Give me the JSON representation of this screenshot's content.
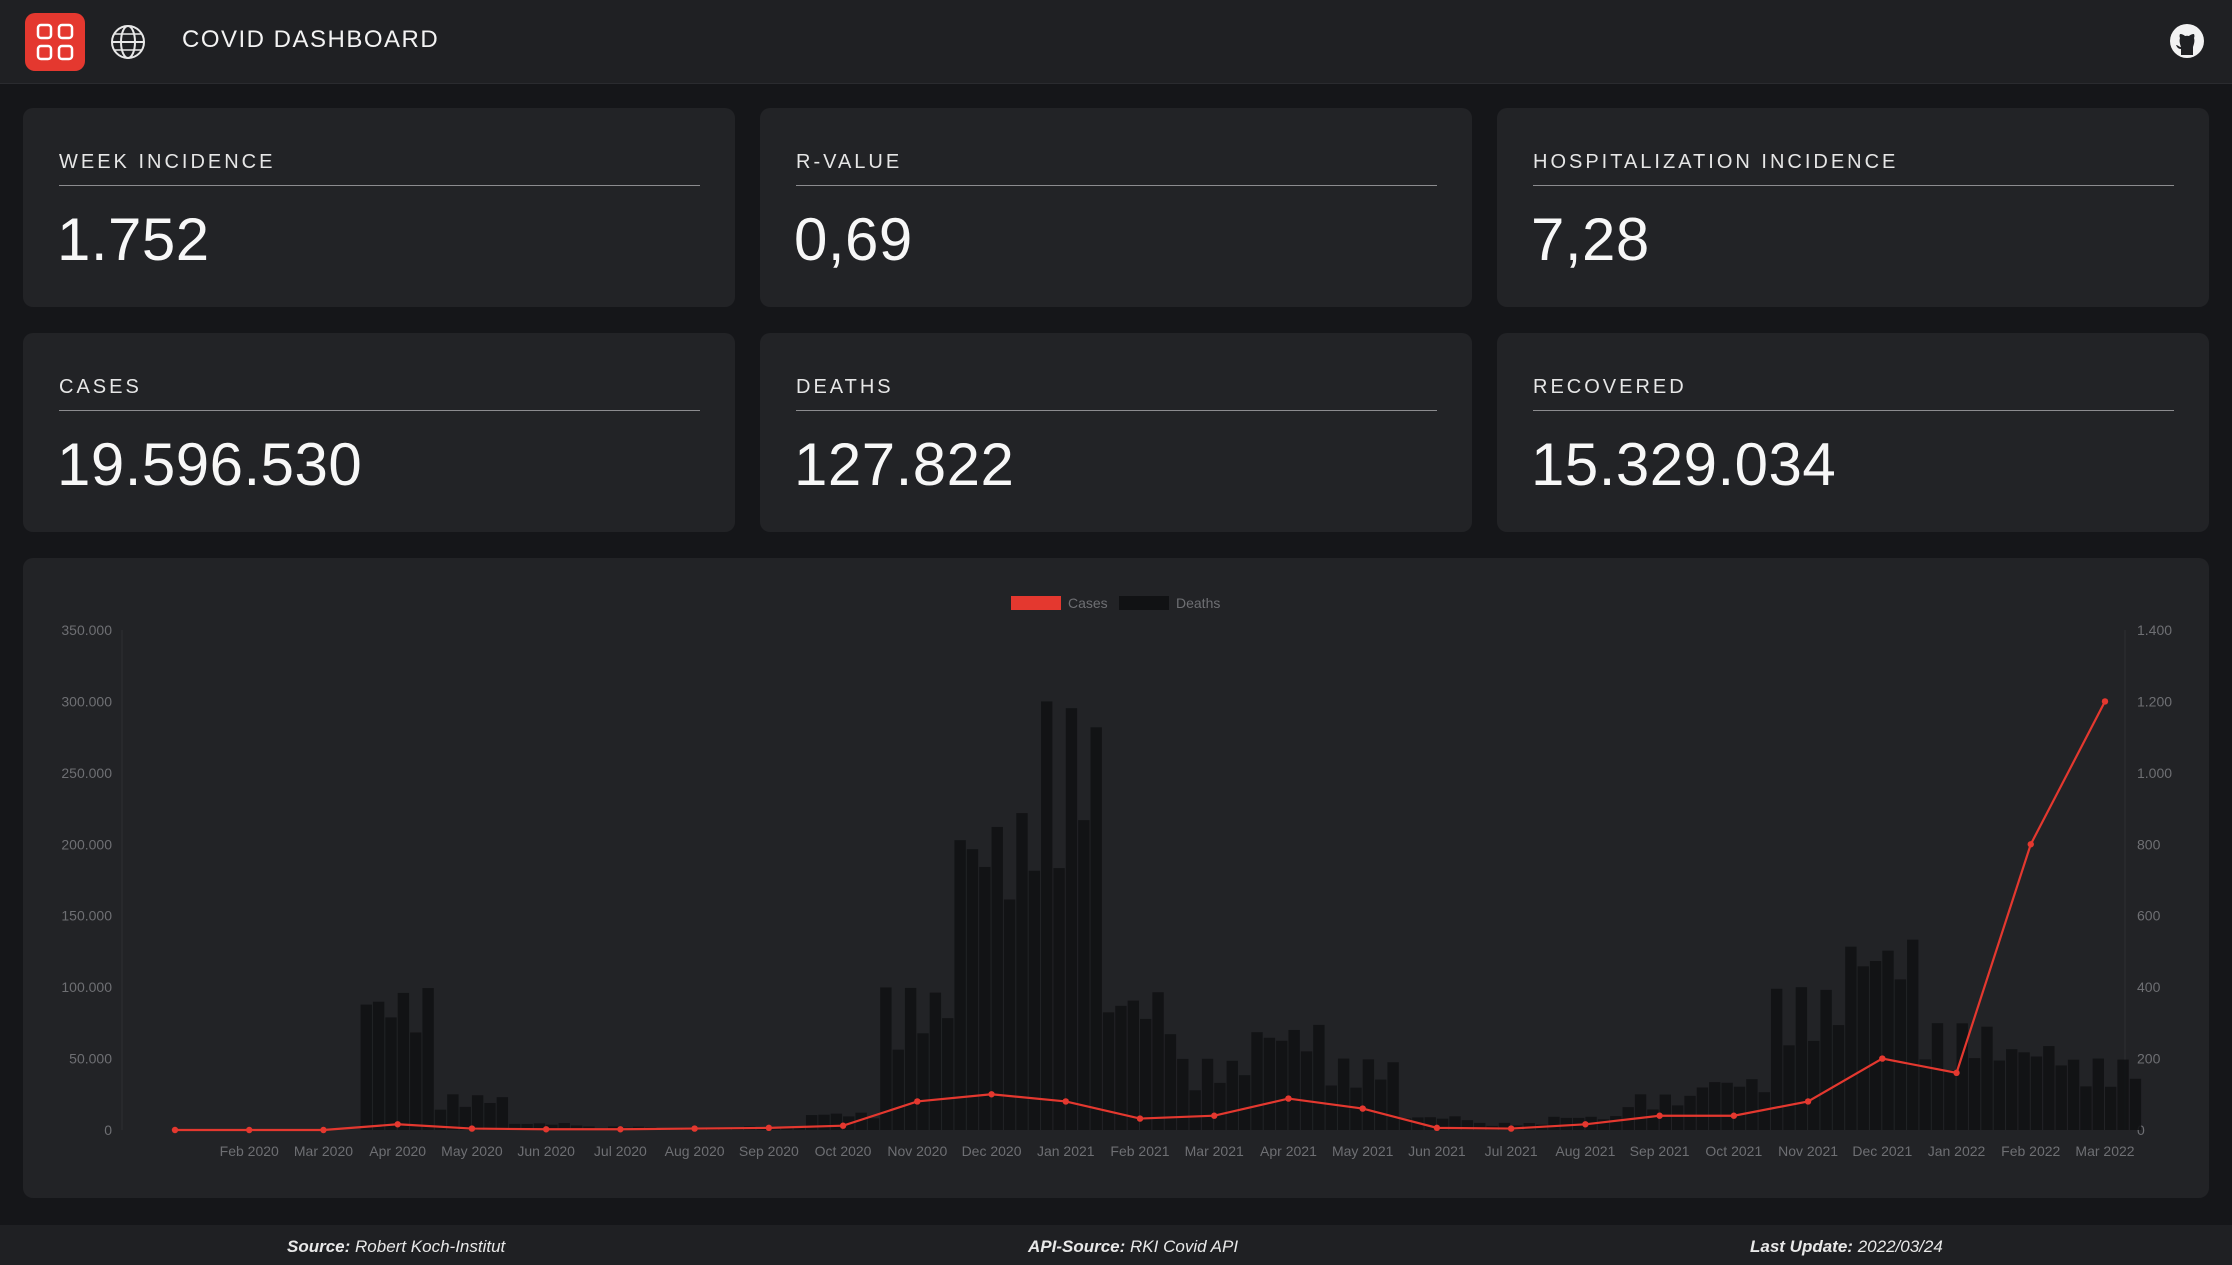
{
  "header": {
    "title": "COVID DASHBOARD",
    "menu_icon": "grid-icon",
    "language_icon": "globe-icon",
    "repo_icon": "github-icon",
    "accent_color": "#e4382f"
  },
  "stats": [
    {
      "label": "WEEK INCIDENCE",
      "value": "1.752"
    },
    {
      "label": "R-VALUE",
      "value": "0,69"
    },
    {
      "label": "HOSPITALIZATION INCIDENCE",
      "value": "7,28"
    },
    {
      "label": "CASES",
      "value": "19.596.530"
    },
    {
      "label": "DEATHS",
      "value": "127.822"
    },
    {
      "label": "RECOVERED",
      "value": "15.329.034"
    }
  ],
  "chart_data": {
    "type": "line",
    "legend_position": "top-center",
    "grid": false,
    "series": [
      {
        "name": "Cases",
        "axis": "left",
        "render": "line",
        "color": "#e4382f",
        "x": [
          "2020-01",
          "2020-02",
          "2020-03",
          "2020-04",
          "2020-05",
          "2020-06",
          "2020-07",
          "2020-08",
          "2020-09",
          "2020-10",
          "2020-11",
          "2020-12",
          "2021-01",
          "2021-02",
          "2021-03",
          "2021-04",
          "2021-05",
          "2021-06",
          "2021-07",
          "2021-08",
          "2021-09",
          "2021-10",
          "2021-11",
          "2021-12",
          "2022-01",
          "2022-02",
          "2022-03"
        ],
        "values": [
          0,
          0,
          0,
          4000,
          1000,
          500,
          500,
          1000,
          1500,
          3000,
          20000,
          25000,
          20000,
          8000,
          10000,
          22000,
          15000,
          1500,
          1000,
          4000,
          10000,
          10000,
          20000,
          50000,
          40000,
          200000,
          300000
        ]
      },
      {
        "name": "Deaths",
        "axis": "right",
        "render": "bar",
        "color": "#111214",
        "x": [
          "2020-01",
          "2020-02",
          "2020-03",
          "2020-04",
          "2020-05",
          "2020-06",
          "2020-07",
          "2020-08",
          "2020-09",
          "2020-10",
          "2020-11",
          "2020-12",
          "2021-01",
          "2021-02",
          "2021-03",
          "2021-04",
          "2021-05",
          "2021-06",
          "2021-07",
          "2021-08",
          "2021-09",
          "2021-10",
          "2021-11",
          "2021-12",
          "2022-01",
          "2022-02",
          "2022-03"
        ],
        "values": [
          0,
          0,
          0,
          400,
          100,
          20,
          10,
          5,
          10,
          50,
          400,
          900,
          1200,
          400,
          200,
          300,
          200,
          40,
          20,
          40,
          100,
          150,
          400,
          550,
          300,
          250,
          200
        ]
      }
    ],
    "y_left": {
      "min": 0,
      "max": 350000,
      "ticks": [
        "0",
        "50.000",
        "100.000",
        "150.000",
        "200.000",
        "250.000",
        "300.000",
        "350.000"
      ]
    },
    "y_right": {
      "min": 0,
      "max": 1400,
      "ticks": [
        "0",
        "200",
        "400",
        "600",
        "800",
        "1.000",
        "1.200",
        "1.400"
      ]
    },
    "x_ticks": [
      "Feb 2020",
      "Mar 2020",
      "Apr 2020",
      "May 2020",
      "Jun 2020",
      "Jul 2020",
      "Aug 2020",
      "Sep 2020",
      "Oct 2020",
      "Nov 2020",
      "Dec 2020",
      "Jan 2021",
      "Feb 2021",
      "Mar 2021",
      "Apr 2021",
      "May 2021",
      "Jun 2021",
      "Jul 2021",
      "Aug 2021",
      "Sep 2021",
      "Oct 2021",
      "Nov 2021",
      "Dec 2021",
      "Jan 2022",
      "Feb 2022",
      "Mar 2022"
    ]
  },
  "footer": {
    "source_label": "Source:",
    "source_value": "Robert Koch-Institut",
    "api_label": "API-Source:",
    "api_value": "RKI Covid API",
    "update_label": "Last Update:",
    "update_value": "2022/03/24"
  }
}
